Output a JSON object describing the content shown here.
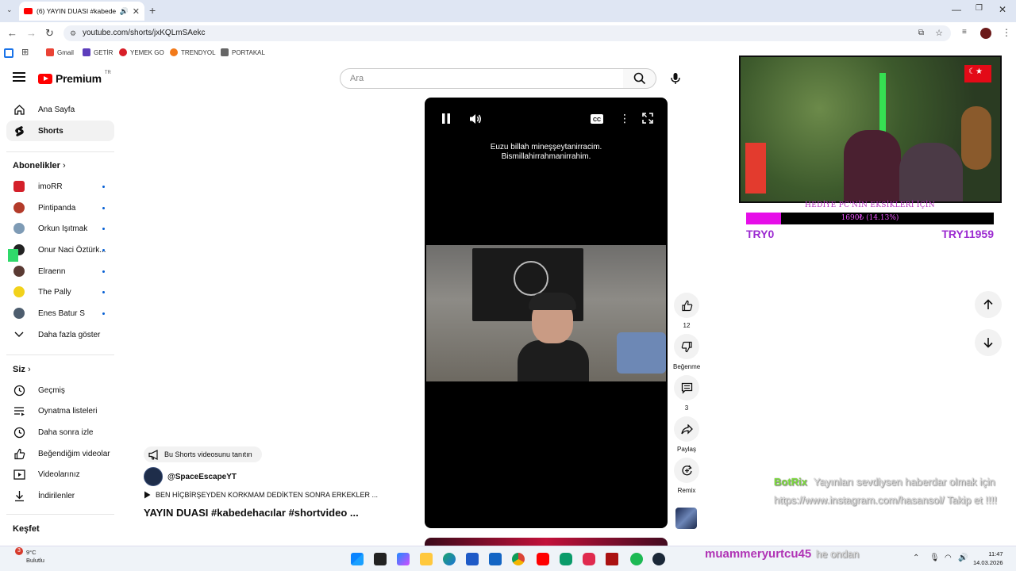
{
  "browser": {
    "tab_title": "(6) YAYIN DUASI #kabedeh...",
    "url": "youtube.com/shorts/jxKQLmSAekc",
    "bookmarks": [
      "Gmail",
      "GETİR",
      "YEMEK GO",
      "TRENDYOL",
      "PORTAKAL"
    ]
  },
  "header": {
    "logo_text": "Premium",
    "logo_region": "TR",
    "search_placeholder": "Ara"
  },
  "sidebar": {
    "main": [
      {
        "label": "Ana Sayfa",
        "icon": "home-icon"
      },
      {
        "label": "Shorts",
        "icon": "shorts-icon"
      }
    ],
    "subscriptions_heading": "Abonelikler",
    "subscriptions": [
      "imoRR",
      "Pintipanda",
      "Orkun Işıtmak",
      "Onur Naci Öztürk...",
      "Elraenn",
      "The Pally",
      "Enes Batur S"
    ],
    "show_more": "Daha fazla göster",
    "you_heading": "Siz",
    "you": [
      {
        "label": "Geçmiş",
        "icon": "history-icon"
      },
      {
        "label": "Oynatma listeleri",
        "icon": "playlist-icon"
      },
      {
        "label": "Daha sonra izle",
        "icon": "clock-icon"
      },
      {
        "label": "Beğendiğim videolar",
        "icon": "thumb-up-icon"
      },
      {
        "label": "Videolarınız",
        "icon": "video-icon"
      },
      {
        "label": "İndirilenler",
        "icon": "download-icon"
      }
    ],
    "explore_heading": "Keşfet"
  },
  "short": {
    "subtitle_line1": "Euzu billah mineşşeytanirracim.",
    "subtitle_line2": "Bismillahirrahmanirrahim.",
    "promo_label": "Bu Shorts videosunu tanıtın",
    "channel": "@SpaceEscapeYT",
    "song": "BEN HİÇBİRŞEYDEN KORKMAM DEDİKTEN SONRA ERKEKLER ...",
    "title": "YAYIN DUASI #kabedehacılar #shortvideo ..."
  },
  "actions": {
    "likes": "12",
    "dislike_label": "Beğenme",
    "comments": "3",
    "share_label": "Paylaş",
    "remix_label": "Remix"
  },
  "overlay": {
    "goal_title": "HEDİYE PC'NİN EKSİKLERİ İÇİN",
    "goal_progress_text": "1690₺ (14.13%)",
    "goal_fraction": 0.1413,
    "goal_min": "TRY0",
    "goal_max": "TRY11959",
    "chat1_user": "BotRix",
    "chat1_msg": "Yayınları sevdiysen haberdar olmak için https://www.instagram.com/hasansol/ Takip et !!!!",
    "chat2_user": "muammeryurtcu45",
    "chat2_msg": "he ondan"
  },
  "taskbar": {
    "weather_temp": "9°C",
    "weather_desc": "Bulutlu",
    "weather_badge": "3",
    "time": "11:47",
    "date": "14.03.2026"
  }
}
